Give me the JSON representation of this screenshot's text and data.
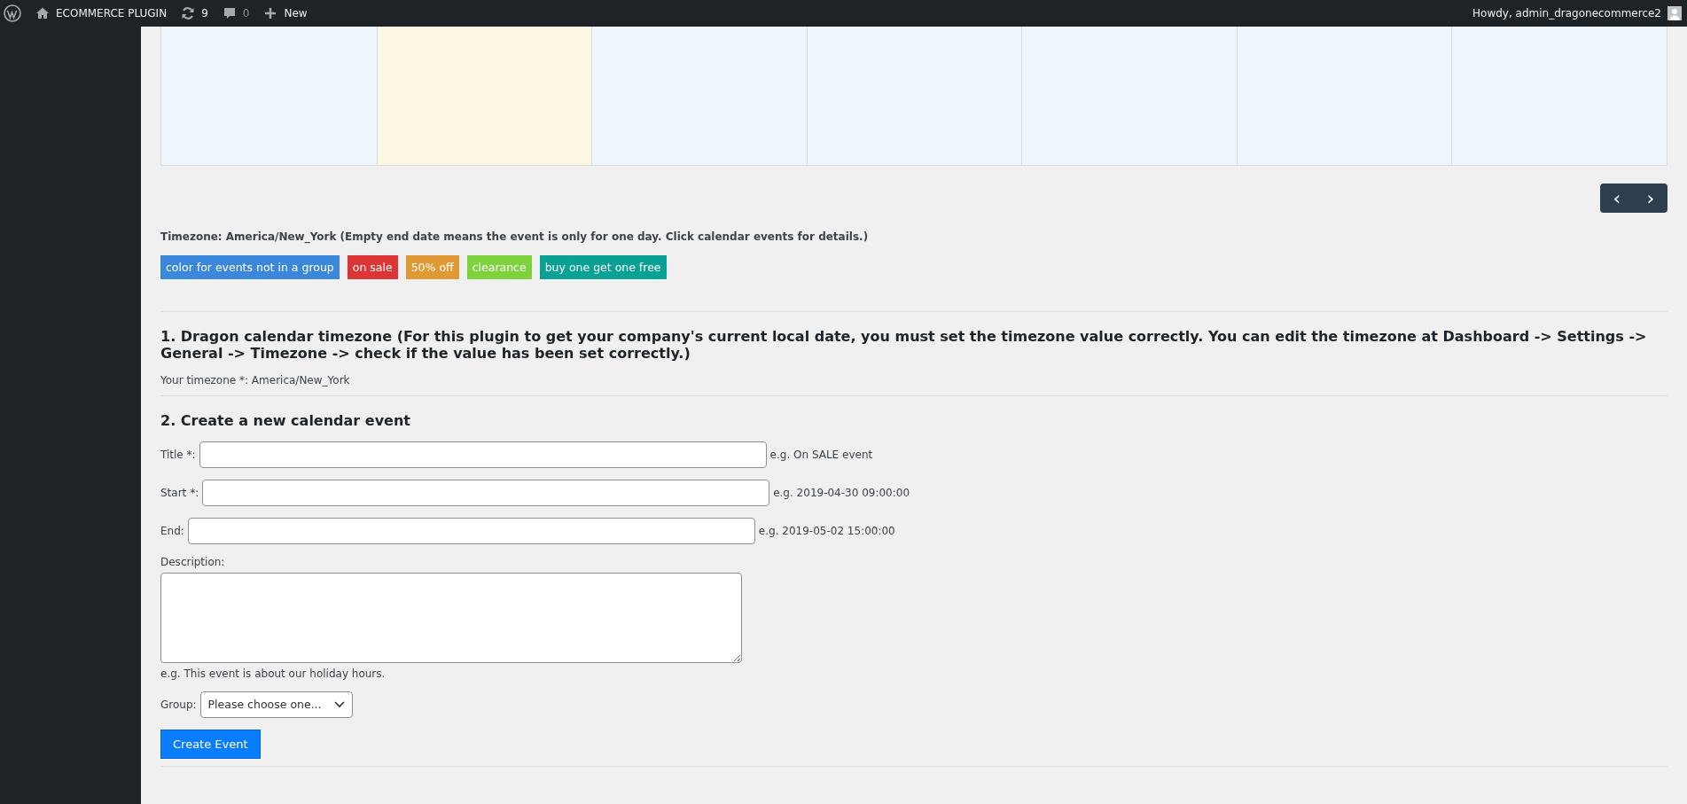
{
  "admin_bar": {
    "site_name": "ECOMMERCE PLUGIN",
    "updates": "9",
    "comments": "0",
    "new_label": "New",
    "greeting": "Howdy, admin_dragonecommerce2"
  },
  "calendar": {
    "cells": [
      {
        "today": false
      },
      {
        "today": true
      },
      {
        "today": false
      },
      {
        "today": false
      },
      {
        "today": false
      },
      {
        "today": false
      },
      {
        "today": false
      }
    ],
    "prev_label": "‹",
    "next_label": "›"
  },
  "timezone_note": "Timezone: America/New_York (Empty end date means the event is only for one day. Click calendar events for details.)",
  "legend": [
    {
      "label": "color for events not in a group",
      "color": "#3a87dc"
    },
    {
      "label": "on sale",
      "color": "#dc3535"
    },
    {
      "label": "50% off",
      "color": "#e09a35"
    },
    {
      "label": "clearance",
      "color": "#7ed23c"
    },
    {
      "label": "buy one get one free",
      "color": "#0aa195"
    }
  ],
  "section_1": {
    "heading": "1. Dragon calendar timezone (For this plugin to get your company's current local date, you must set the timezone value correctly. You can edit the timezone at Dashboard -> Settings -> General -> Timezone -> check if the value has been set correctly.)",
    "timezone_line": "Your timezone *: America/New_York"
  },
  "section_2": {
    "heading": "2. Create a new calendar event",
    "fields": [
      {
        "kind": "input",
        "label": "Title *:",
        "hint": "e.g. On SALE event"
      },
      {
        "kind": "input",
        "label": "Start *:",
        "hint": "e.g. 2019-04-30 09:00:00"
      },
      {
        "kind": "input",
        "label": "End:",
        "hint": "e.g. 2019-05-02 15:00:00"
      },
      {
        "kind": "textarea",
        "label": "Description:",
        "hint": "e.g. This event is about our holiday hours."
      },
      {
        "kind": "select",
        "label": "Group:",
        "value": "Please choose one..."
      }
    ],
    "submit": "Create Event"
  }
}
